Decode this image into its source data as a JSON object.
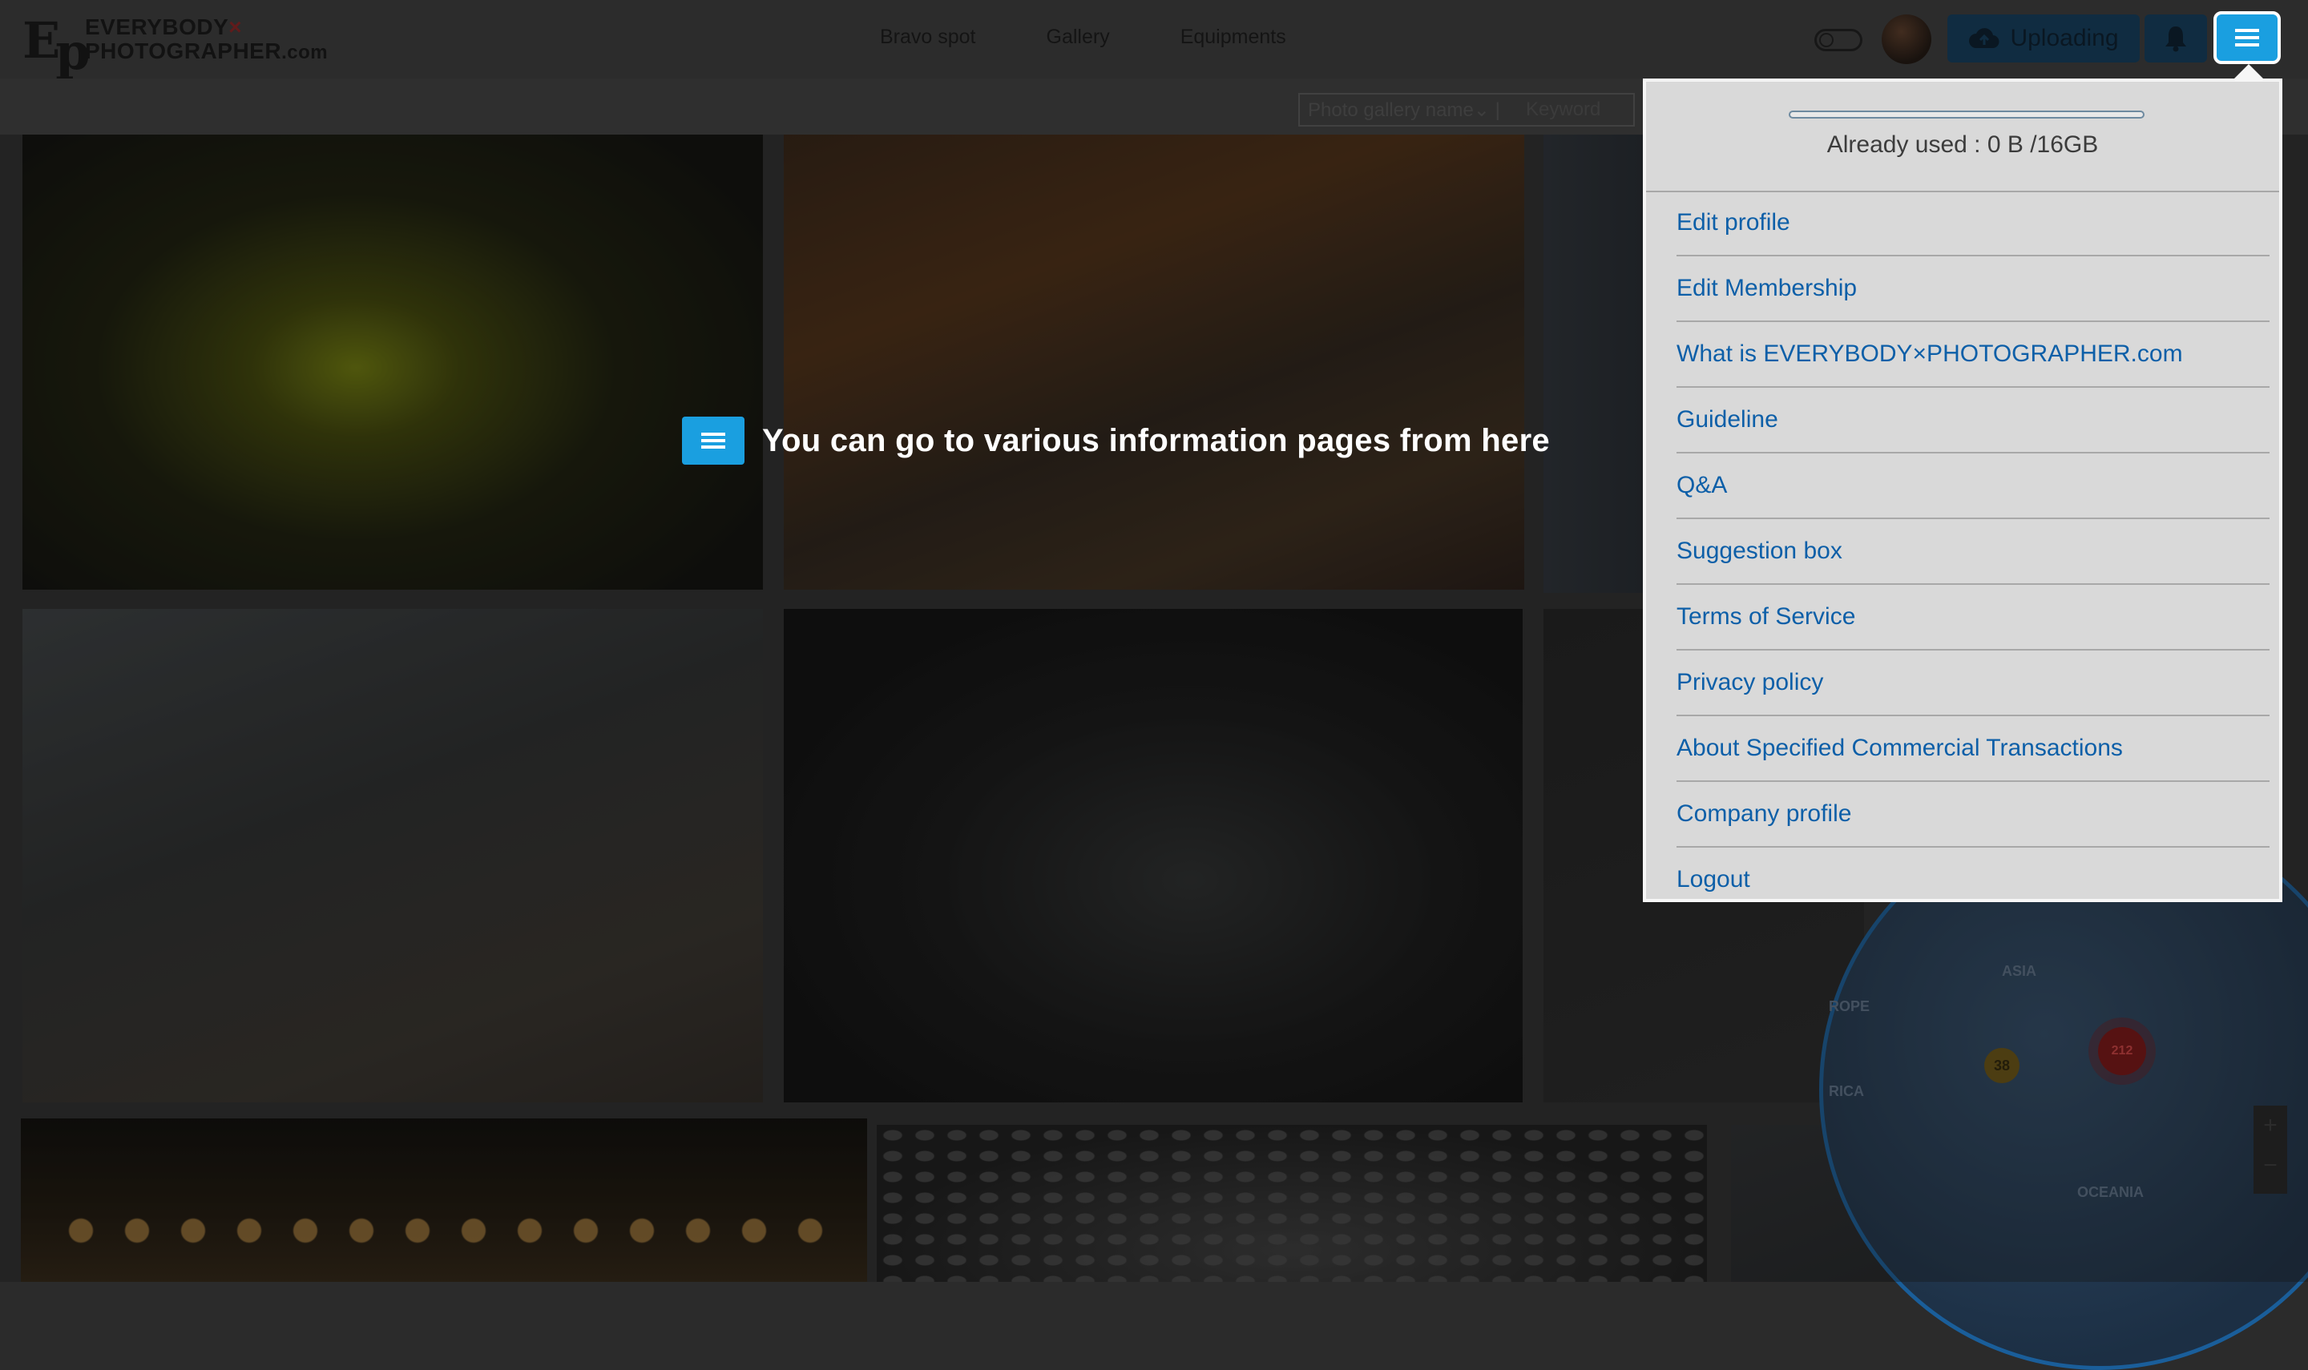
{
  "header": {
    "logo_mark": "Ep",
    "logo_line1": "EVERYBODY",
    "logo_x": "×",
    "logo_line2": "PHOTOGRAPHER",
    "logo_domain": ".com",
    "nav": [
      "Bravo spot",
      "Gallery",
      "Equipments"
    ],
    "upload_label": "Uploading"
  },
  "search": {
    "select_value": "Photo gallery name⌄ |",
    "placeholder": "Keyword"
  },
  "tooltip": {
    "text": "You can go to various information pages from here"
  },
  "dropdown": {
    "usage_text": "Already used : 0 B /16GB",
    "usage_fraction": 0,
    "items": [
      "Edit profile",
      "Edit Membership",
      "What is EVERYBODY×PHOTOGRAPHER.com",
      "Guideline",
      "Q&A",
      "Suggestion box",
      "Terms of Service",
      "Privacy policy",
      "About Specified Commercial Transactions",
      "Company profile",
      "Logout"
    ]
  },
  "map": {
    "labels": [
      "ASIA",
      "ROPE",
      "RICA",
      "OCEANIA"
    ],
    "clusters": [
      "212",
      "38"
    ],
    "zoom_in": "+",
    "zoom_out": "−"
  },
  "colors": {
    "accent": "#1a9fe0",
    "link": "#0d5fa8",
    "overlay": "#2b2b2b"
  }
}
